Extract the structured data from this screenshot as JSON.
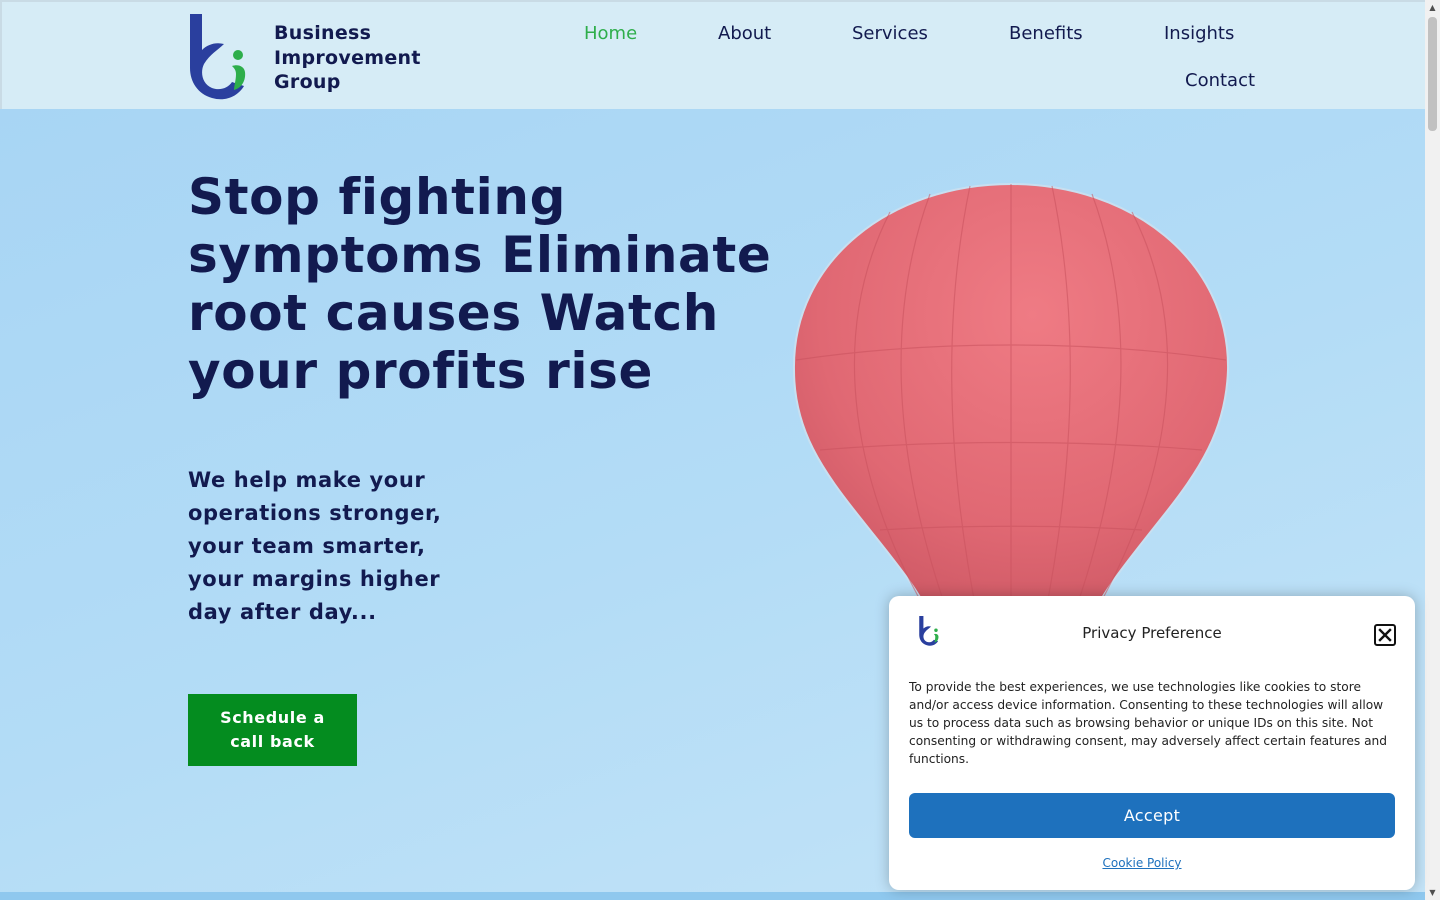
{
  "brand": {
    "name_lines": [
      "Business",
      "Improvement",
      "Group"
    ],
    "logo_icon": "bi-logo-icon",
    "primary_color": "#2a3f9e",
    "accent_color": "#2eae4b"
  },
  "nav": {
    "items": [
      {
        "label": "Home",
        "active": true
      },
      {
        "label": "About",
        "active": false
      },
      {
        "label": "Services",
        "active": false
      },
      {
        "label": "Benefits",
        "active": false
      },
      {
        "label": "Insights",
        "active": false
      },
      {
        "label": "Contact",
        "active": false
      }
    ]
  },
  "hero": {
    "title": "Stop fighting symptoms Eliminate root causes Watch your profits rise",
    "subtitle": "We help make your operations stronger, your team smarter, your margins higher day after day...",
    "cta_label": "Schedule a call back",
    "cta_color": "#048c1f",
    "image": "hot-air-balloon"
  },
  "cookie_dialog": {
    "title": "Privacy Preference",
    "body": "To provide the best experiences, we use technologies like cookies to store and/or access device information. Consenting to these technologies will allow us to process data such as browsing behavior or unique IDs on this site. Not consenting or withdrawing consent, may adversely affect certain features and functions.",
    "accept_label": "Accept",
    "accept_color": "#1e71bd",
    "policy_link": "Cookie Policy",
    "close_icon": "close-icon"
  }
}
